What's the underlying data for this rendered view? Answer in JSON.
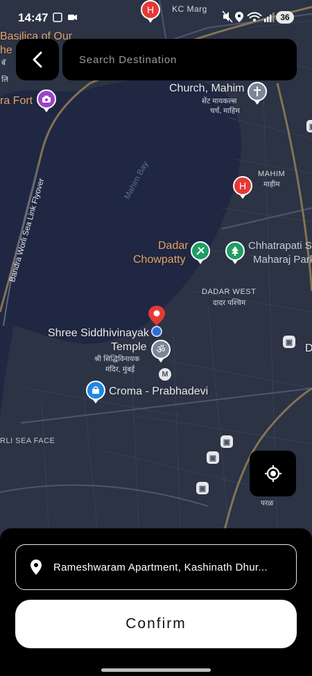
{
  "status_bar": {
    "time": "14:47",
    "battery": "36"
  },
  "map": {
    "labels": {
      "kc_marg": "KC Marg",
      "basilica_1": "Basilica of Our",
      "basilica_2": "he",
      "basilica_marathi": "बॅ",
      "fort": "ra Fort",
      "church": "Church, Mahim",
      "church_marathi_1": "सेंट मायकल्स",
      "church_marathi_2": "चर्च, माहिम",
      "mahim": "MAHIM",
      "mahim_marathi": "माहीम",
      "mahim_bay": "Mahim Bay",
      "flyover": "Bandra Worli Sea Link Flyover",
      "dadar_chowpatty_1": "Dadar",
      "dadar_chowpatty_2": "Chowpatty",
      "shivaji_park_1": "Chhatrapati S",
      "shivaji_park_2": "Maharaj Park",
      "dadar_west": "DADAR WEST",
      "dadar_west_marathi": "दादर पश्चिम",
      "siddhivinayak_1": "Shree Siddhivinayak",
      "siddhivinayak_2": "Temple",
      "siddhivinayak_marathi_1": "श्री सिद्धिविनायक",
      "siddhivinayak_marathi_2": "मंदिर, मुंबई",
      "croma": "Croma - Prabhadevi",
      "sea_face": "RLI SEA FACE",
      "parel_marathi": "परळ",
      "right_edge": "D",
      "lew": "लि"
    }
  },
  "search": {
    "placeholder": "Search Destination"
  },
  "bottom_sheet": {
    "address": "Rameshwaram Apartment, Kashinath Dhur...",
    "confirm_label": "Confirm"
  },
  "icons": {
    "back": "chevron-left-icon",
    "locate": "my-location-icon",
    "address_pin": "location-pin-icon"
  },
  "colors": {
    "map_land": "#2b3344",
    "map_water": "#1f2742",
    "accent": "#ffffff",
    "pin_red": "#e53935"
  }
}
